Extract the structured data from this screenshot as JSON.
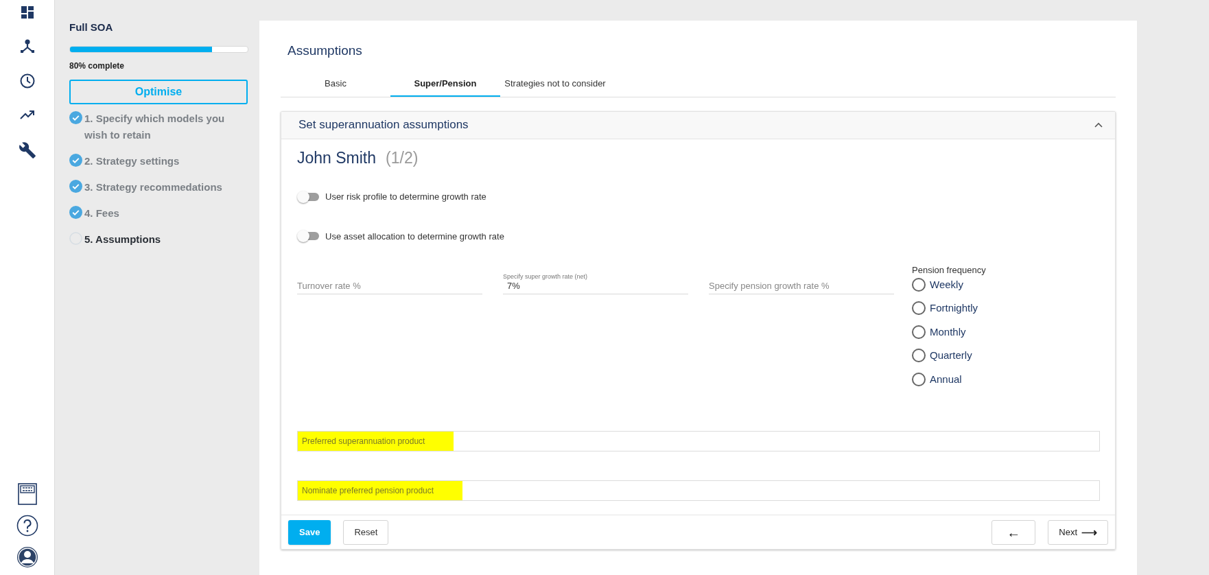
{
  "nav_icons": {
    "top": [
      {
        "kind": "dashboard"
      },
      {
        "kind": "network"
      },
      {
        "kind": "clock"
      },
      {
        "kind": "trend"
      },
      {
        "kind": "wrench"
      }
    ],
    "bottom": [
      {
        "kind": "form"
      },
      {
        "kind": "help"
      },
      {
        "kind": "user"
      }
    ]
  },
  "sidebar": {
    "title": "Full SOA",
    "progress": {
      "level": 0.8,
      "label": "80% complete"
    },
    "optimise_button": "Optimise",
    "steps": [
      {
        "label": "1. Specify which models you wish to retain",
        "done": true
      },
      {
        "label": "2. Strategy settings",
        "done": true
      },
      {
        "label": "3. Strategy recommedations",
        "done": true
      },
      {
        "label": "4. Fees",
        "done": true
      },
      {
        "label": "5. Assumptions",
        "done": false
      }
    ]
  },
  "page_title": "Assumptions",
  "tabs": [
    {
      "label": "Basic",
      "selected": false
    },
    {
      "label": "Super/Pension",
      "selected": true
    },
    {
      "label": "Strategies not to consider",
      "selected": false
    }
  ],
  "panel": {
    "title": "Set superannuation assumptions",
    "expanded": true,
    "person": "John Smith",
    "person_count": "(1/2)",
    "toggles": [
      {
        "label": "User risk profile to determine growth rate",
        "on": false
      },
      {
        "label": "Use asset allocation to determine growth rate",
        "on": false
      }
    ],
    "fields": [
      {
        "placeholder": "Turnover rate %"
      },
      {
        "label": "Specify super growth rate (net)",
        "value": "7%"
      },
      {
        "placeholder": "Specify pension growth rate %"
      }
    ],
    "pension_frequency": {
      "label": "Pension frequency",
      "options": [
        {
          "label": "Weekly",
          "selected": false
        },
        {
          "label": "Fortnightly",
          "selected": false
        },
        {
          "label": "Monthly",
          "selected": false
        },
        {
          "label": "Quarterly",
          "selected": false
        },
        {
          "label": "Annual",
          "selected": false
        }
      ]
    },
    "product_fields": [
      {
        "placeholder": "Preferred superannuation product",
        "highlighted": true
      },
      {
        "placeholder": "Nominate preferred pension product",
        "highlighted": true
      }
    ]
  },
  "footer": {
    "save": "Save",
    "reset": "Reset",
    "back": "←",
    "next": "Next",
    "next_arrow": "⟶"
  }
}
